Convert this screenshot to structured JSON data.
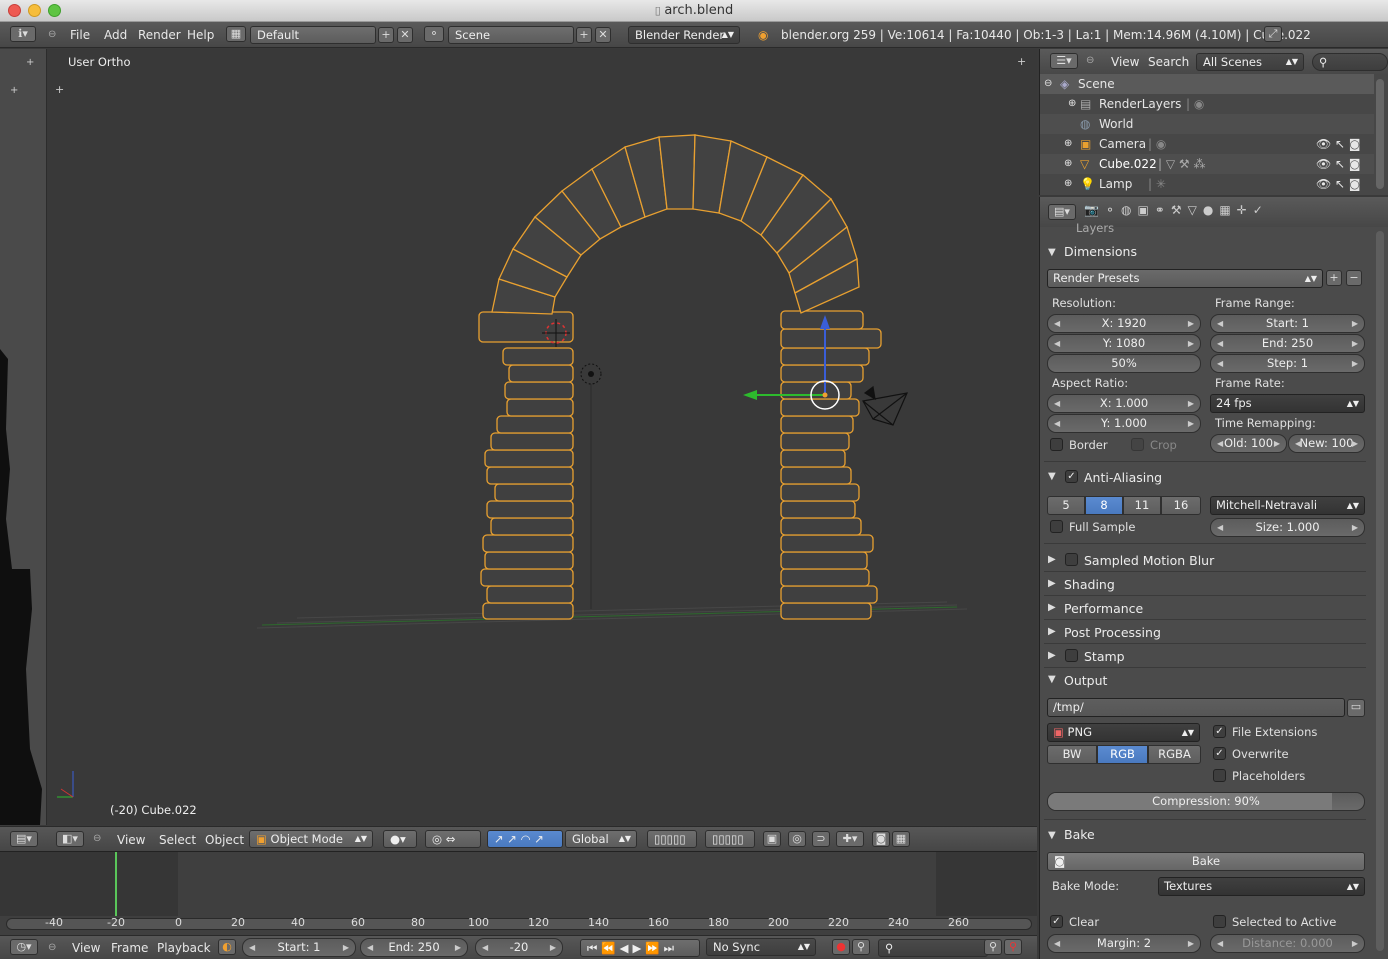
{
  "window": {
    "title": "arch.blend"
  },
  "infobar": {
    "menus": [
      "File",
      "Add",
      "Render",
      "Help"
    ],
    "layout": "Default",
    "scene": "Scene",
    "engine": "Blender Render",
    "stats": "blender.org 259 | Ve:10614 | Fa:10440 | Ob:1-3 | La:1 | Mem:14.96M (4.10M) | Cube.022"
  },
  "viewport": {
    "view_label": "User Ortho",
    "object_label": "(-20) Cube.022",
    "header": {
      "menus": [
        "View",
        "Select",
        "Object"
      ],
      "mode": "Object Mode",
      "orientation": "Global"
    }
  },
  "timeline": {
    "ticks": [
      "-40",
      "-20",
      "0",
      "20",
      "40",
      "60",
      "80",
      "100",
      "120",
      "140",
      "160",
      "180",
      "200",
      "220",
      "240",
      "260"
    ],
    "menus": [
      "View",
      "Frame",
      "Playback"
    ],
    "start": "Start: 1",
    "end": "End: 250",
    "current": "-20",
    "sync": "No Sync"
  },
  "outliner": {
    "menus": [
      "View",
      "Search"
    ],
    "filter": "All Scenes",
    "items": [
      {
        "label": "Scene"
      },
      {
        "label": "RenderLayers"
      },
      {
        "label": "World"
      },
      {
        "label": "Camera"
      },
      {
        "label": "Cube.022"
      },
      {
        "label": "Lamp"
      }
    ]
  },
  "properties": {
    "layers_label": "Layers",
    "dimensions": {
      "title": "Dimensions",
      "presets": "Render Presets",
      "resolution_label": "Resolution:",
      "res_x": "X: 1920",
      "res_y": "Y: 1080",
      "res_pct": "50%",
      "frame_range_label": "Frame Range:",
      "start": "Start: 1",
      "end": "End: 250",
      "step": "Step: 1",
      "aspect_label": "Aspect Ratio:",
      "asp_x": "X: 1.000",
      "asp_y": "Y: 1.000",
      "frame_rate_label": "Frame Rate:",
      "fps": "24 fps",
      "time_remap_label": "Time Remapping:",
      "old": "Old: 100",
      "new": "New: 100",
      "border": "Border",
      "crop": "Crop"
    },
    "antialiasing": {
      "title": "Anti-Aliasing",
      "samples": [
        "5",
        "8",
        "11",
        "16"
      ],
      "filter": "Mitchell-Netravali",
      "full_sample": "Full Sample",
      "size": "Size: 1.000"
    },
    "collapsed_panels": [
      "Sampled Motion Blur",
      "Shading",
      "Performance",
      "Post Processing",
      "Stamp"
    ],
    "output": {
      "title": "Output",
      "path": "/tmp/",
      "format": "PNG",
      "file_ext": "File Extensions",
      "overwrite": "Overwrite",
      "placeholders": "Placeholders",
      "modes": [
        "BW",
        "RGB",
        "RGBA"
      ],
      "compression": "Compression: 90%",
      "compression_value": 90
    },
    "bake": {
      "title": "Bake",
      "button": "Bake",
      "mode_label": "Bake Mode:",
      "mode": "Textures",
      "clear": "Clear",
      "selected_to_active": "Selected to Active",
      "margin": "Margin: 2",
      "distance": "Distance: 0.000"
    }
  },
  "colors": {
    "accent": "#5a8ad0",
    "selection": "#f0a030",
    "bg": "#393939"
  }
}
